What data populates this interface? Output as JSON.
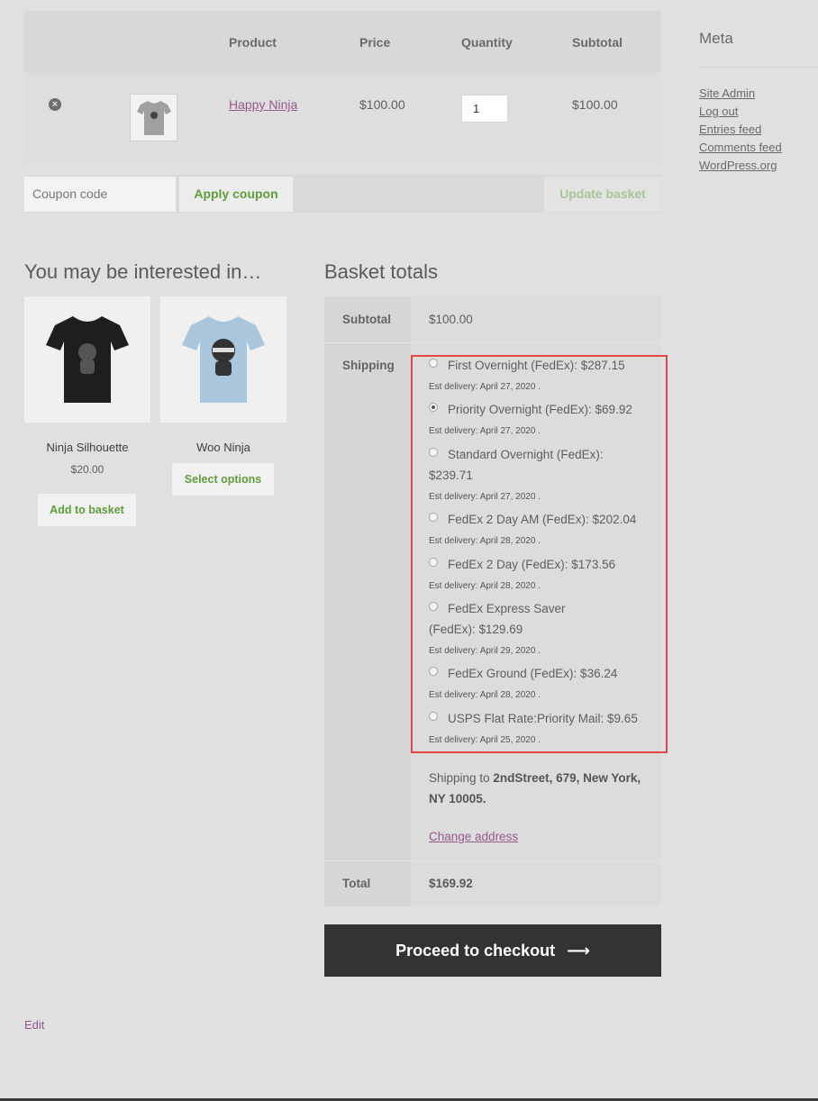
{
  "cart": {
    "headers": {
      "product": "Product",
      "price": "Price",
      "quantity": "Quantity",
      "subtotal": "Subtotal"
    },
    "item": {
      "name": "Happy Ninja",
      "price": "$100.00",
      "quantity": "1",
      "subtotal": "$100.00",
      "remove_icon": "×"
    }
  },
  "coupon": {
    "placeholder": "Coupon code",
    "apply_label": "Apply coupon",
    "update_label": "Update basket"
  },
  "sidebar": {
    "title": "Meta",
    "links": [
      "Site Admin",
      "Log out",
      "Entries feed",
      "Comments feed",
      "WordPress.org"
    ]
  },
  "cross_sells": {
    "title": "You may be interested in…",
    "products": [
      {
        "name": "Ninja Silhouette",
        "price": "$20.00",
        "button": "Add to basket",
        "color": "#1e1e1e"
      },
      {
        "name": "Woo Ninja",
        "price": "",
        "button": "Select options",
        "color": "#a9c6dc"
      }
    ]
  },
  "totals": {
    "title": "Basket totals",
    "subtotal_label": "Subtotal",
    "subtotal_value": "$100.00",
    "shipping_label": "Shipping",
    "shipping_options": [
      {
        "label": "First Overnight (FedEx): $287.15",
        "est": "Est delivery: April 27, 2020 .",
        "checked": false
      },
      {
        "label": "Priority Overnight (FedEx): $69.92",
        "est": "Est delivery: April 27, 2020 .",
        "checked": true
      },
      {
        "label": "Standard Overnight (FedEx): $239.71",
        "est": "Est delivery: April 27, 2020 .",
        "checked": false
      },
      {
        "label": "FedEx 2 Day AM (FedEx): $202.04",
        "est": "Est delivery: April 28, 2020 .",
        "checked": false
      },
      {
        "label": "FedEx 2 Day (FedEx): $173.56",
        "est": "Est delivery: April 28, 2020 .",
        "checked": false
      },
      {
        "label": "FedEx Express Saver (FedEx): $129.69",
        "est": "Est delivery: April 29, 2020 .",
        "checked": false
      },
      {
        "label": "FedEx Ground (FedEx): $36.24",
        "est": "Est delivery: April 28, 2020 .",
        "checked": false
      },
      {
        "label": "USPS Flat Rate:Priority Mail: $9.65",
        "est": "Est delivery: April 25, 2020 .",
        "checked": false
      }
    ],
    "shipping_to_prefix": "Shipping to ",
    "shipping_to_address": "2ndStreet, 679, New York, NY 10005.",
    "change_address": "Change address",
    "total_label": "Total",
    "total_value": "$169.92"
  },
  "checkout": {
    "label": "Proceed to checkout",
    "arrow_icon": "⟶"
  },
  "edit_link": "Edit",
  "colors": {
    "link": "#96588a",
    "button_text": "#5f9d3b",
    "checkout_bg": "#333333",
    "highlight": "#e04848"
  }
}
